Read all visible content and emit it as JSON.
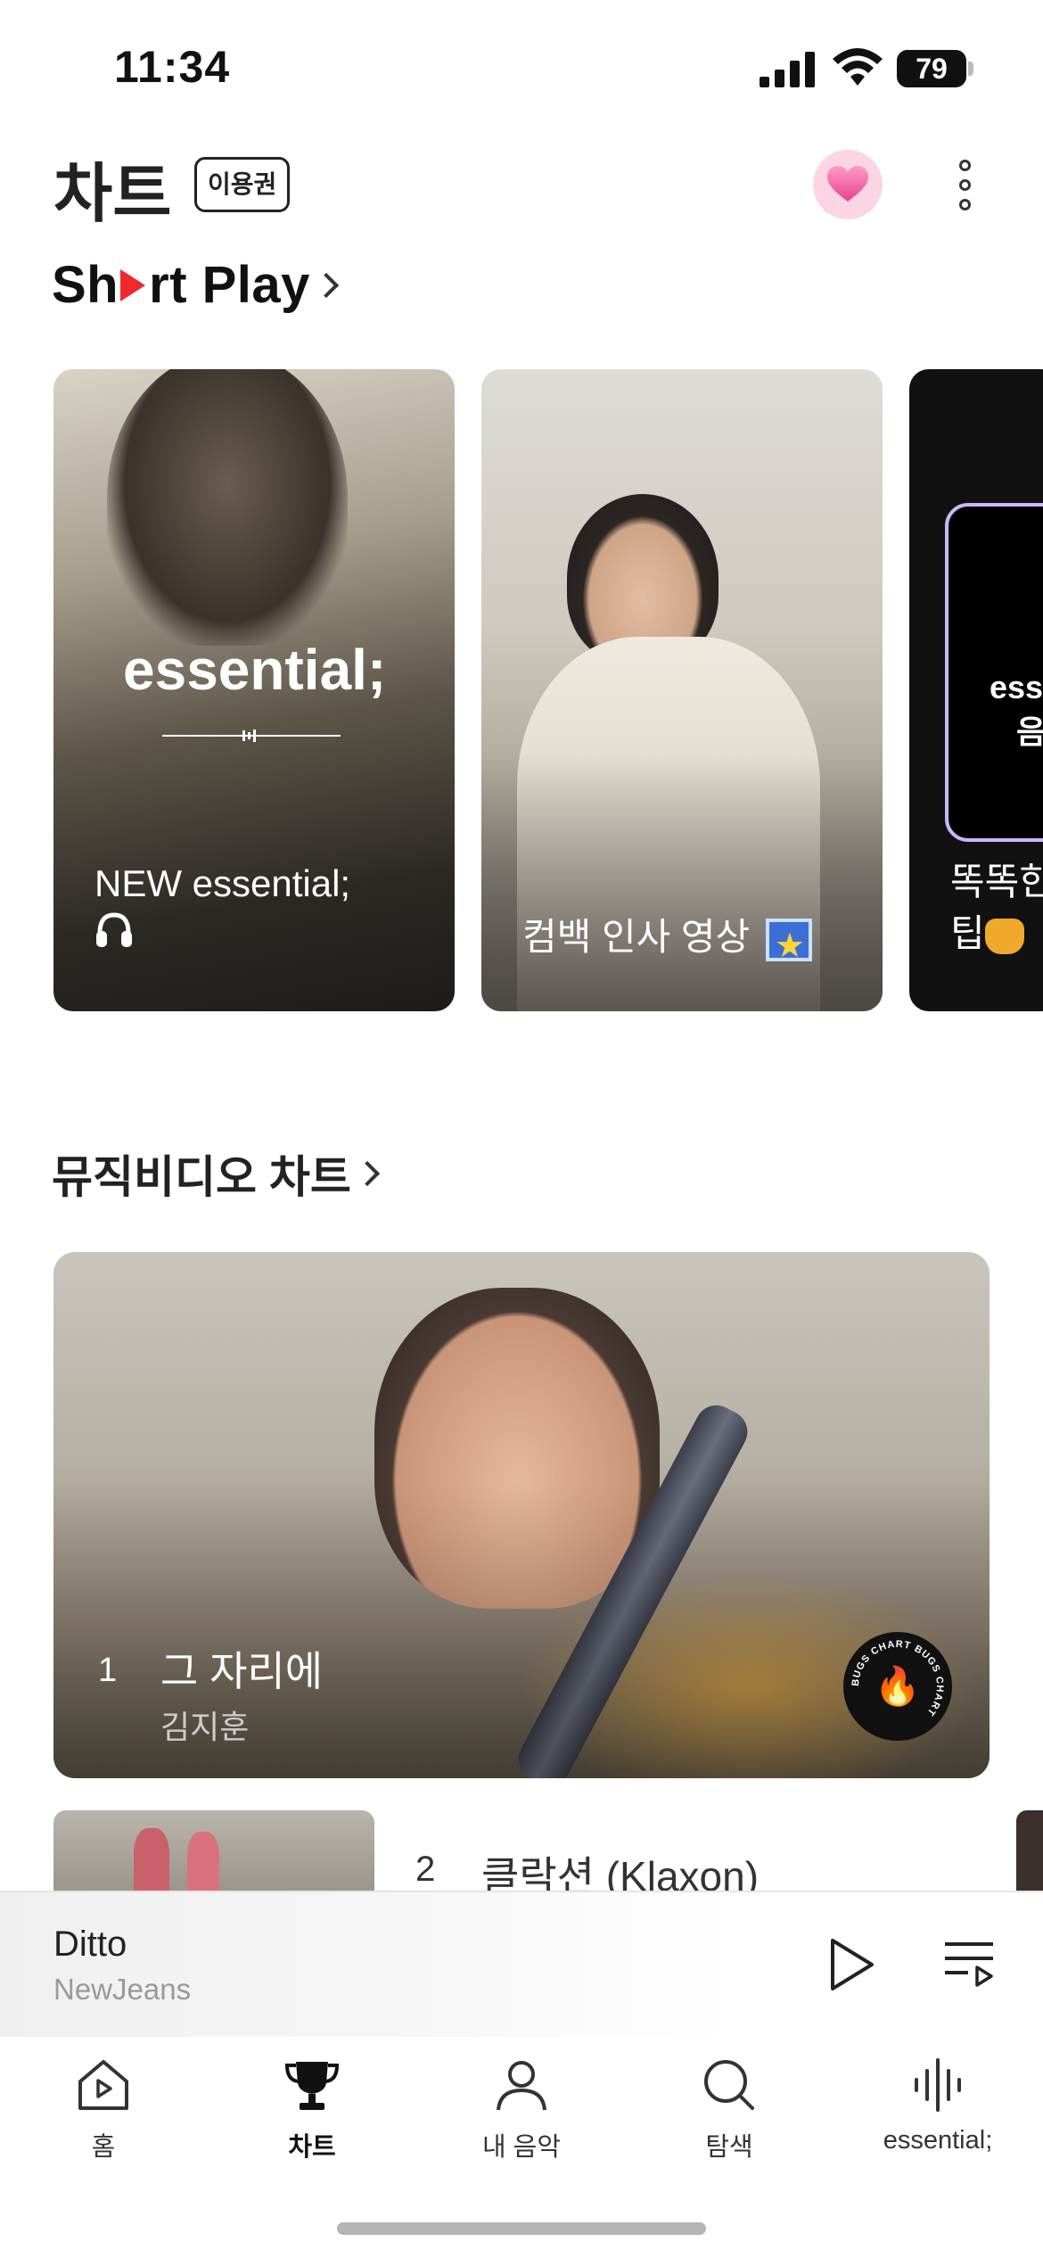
{
  "status_bar": {
    "time": "11:34",
    "battery": "79"
  },
  "header": {
    "title": "차트",
    "pass_badge": "이용권",
    "icons": [
      "heart-icon",
      "more-vertical-icon"
    ]
  },
  "short_play": {
    "heading_left": "Sh",
    "heading_right": "rt Play",
    "cards": [
      {
        "brand_text": "essential;",
        "caption_line1": "NEW essential;",
        "caption_icon": "headphones-icon"
      },
      {
        "caption": "컴백 인사 영상",
        "caption_icon": "star-box-icon"
      },
      {
        "frame_text_a": "ess",
        "frame_text_b": "음",
        "caption_line1": "똑똑한",
        "caption_line2": "팁",
        "caption_icon": "honey-pot-icon"
      }
    ]
  },
  "music_video_chart": {
    "heading": "뮤직비디오 차트",
    "featured": {
      "rank": "1",
      "title": "그 자리에",
      "artist": "김지훈",
      "badge_text": "BUGS CHART BUGS CHART"
    },
    "items": [
      {
        "rank": "2",
        "title": "클락션 (Klaxon)"
      }
    ]
  },
  "mini_player": {
    "title": "Ditto",
    "artist": "NewJeans"
  },
  "bottom_nav": {
    "items": [
      {
        "label": "홈",
        "icon": "home-play-icon",
        "active": false
      },
      {
        "label": "차트",
        "icon": "trophy-icon",
        "active": true
      },
      {
        "label": "내 음악",
        "icon": "person-icon",
        "active": false
      },
      {
        "label": "탐색",
        "icon": "search-icon",
        "active": false
      },
      {
        "label": "essential;",
        "icon": "waveform-icon",
        "active": false
      }
    ]
  },
  "colors": {
    "accent_red": "#f0282d",
    "heart_bg": "#fbd5e3",
    "heart": "#f06ea5"
  }
}
